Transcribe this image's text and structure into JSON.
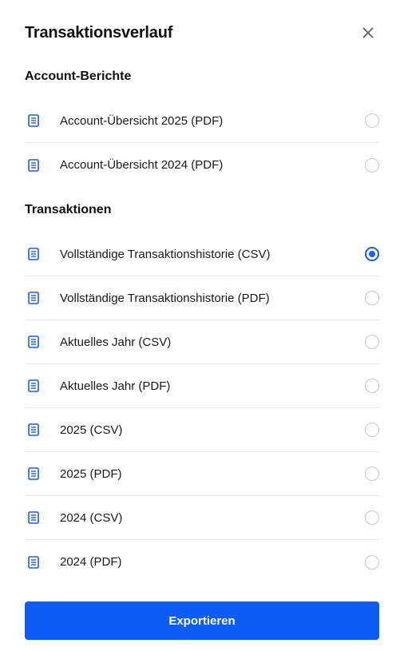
{
  "header": {
    "title": "Transaktionsverlauf",
    "close_icon": "close-icon"
  },
  "sections": [
    {
      "title": "Account-Berichte",
      "items": [
        {
          "label": "Account-Übersicht 2025 (PDF)",
          "selected": false
        },
        {
          "label": "Account-Übersicht 2024 (PDF)",
          "selected": false
        }
      ]
    },
    {
      "title": "Transaktionen",
      "items": [
        {
          "label": "Vollständige Transaktionshistorie (CSV)",
          "selected": true
        },
        {
          "label": "Vollständige Transaktionshistorie (PDF)",
          "selected": false
        },
        {
          "label": "Aktuelles Jahr (CSV)",
          "selected": false
        },
        {
          "label": "Aktuelles Jahr (PDF)",
          "selected": false
        },
        {
          "label": "2025 (CSV)",
          "selected": false
        },
        {
          "label": "2025 (PDF)",
          "selected": false
        },
        {
          "label": "2024 (CSV)",
          "selected": false
        },
        {
          "label": "2024 (PDF)",
          "selected": false
        }
      ]
    }
  ],
  "footer": {
    "export_label": "Exportieren"
  },
  "colors": {
    "accent": "#0d5cf5",
    "icon": "#1a5cf5",
    "divider": "#e9e9ec",
    "radio_border": "#c8c8cc"
  }
}
